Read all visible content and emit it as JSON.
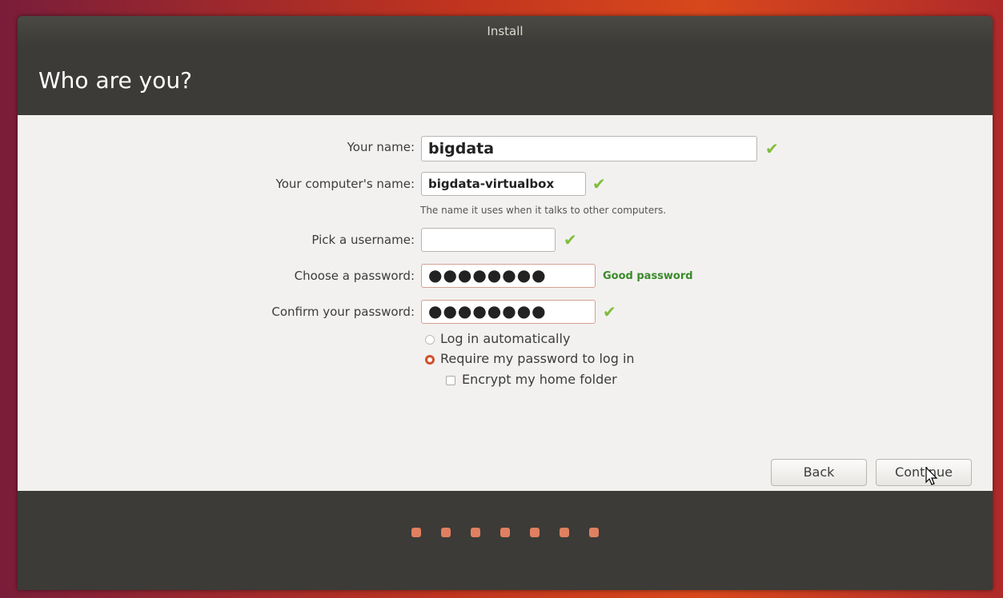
{
  "window": {
    "title": "Install"
  },
  "page": {
    "heading": "Who are you?"
  },
  "form": {
    "your_name_label": "Your name:",
    "your_name_value": "bigdata",
    "computer_name_label": "Your computer's name:",
    "computer_name_value": "bigdata-virtualbox",
    "computer_name_hint": "The name it uses when it talks to other computers.",
    "username_label": "Pick a username:",
    "username_value": "",
    "password_label": "Choose a password:",
    "password_value": "●●●●●●●●",
    "password_strength": "Good password",
    "confirm_label": "Confirm your password:",
    "confirm_value": "●●●●●●●●",
    "login_auto_label": "Log in automatically",
    "require_password_label": "Require my password to log in",
    "encrypt_label": "Encrypt my home folder",
    "selected_login_option": "Require my password to log in"
  },
  "buttons": {
    "back": "Back",
    "continue": "Continue"
  },
  "progress": {
    "total_steps": 7
  },
  "colors": {
    "accent": "#dd4814",
    "check": "#7fbd3a",
    "good": "#3a8a2a"
  },
  "icons": {
    "valid": "checkmark-icon",
    "cursor": "mouse-pointer-icon"
  }
}
